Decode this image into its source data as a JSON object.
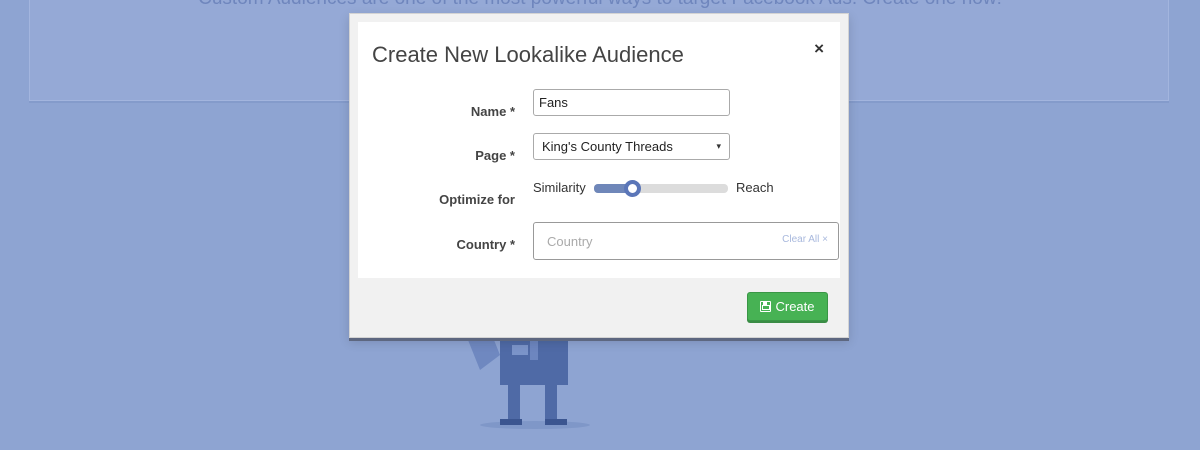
{
  "background": {
    "headline": "Custom Audiences are one of the most powerful ways to target Facebook Ads. Create one now!"
  },
  "modal": {
    "title": "Create New Lookalike Audience",
    "close_label": "×",
    "fields": {
      "name": {
        "label": "Name *",
        "value": "Fans"
      },
      "page": {
        "label": "Page *",
        "selected": "King's County Threads",
        "caret": "▾"
      },
      "optimize": {
        "label": "Optimize for",
        "left_label": "Similarity",
        "right_label": "Reach",
        "level": 0.28
      },
      "country": {
        "label": "Country *",
        "placeholder": "Country",
        "clear_label": "Clear All ×"
      }
    },
    "create_label": "Create"
  },
  "colors": {
    "accent": "#47b254",
    "slider_handle": "#5b76b8",
    "backdrop": "#8ea4d2"
  }
}
